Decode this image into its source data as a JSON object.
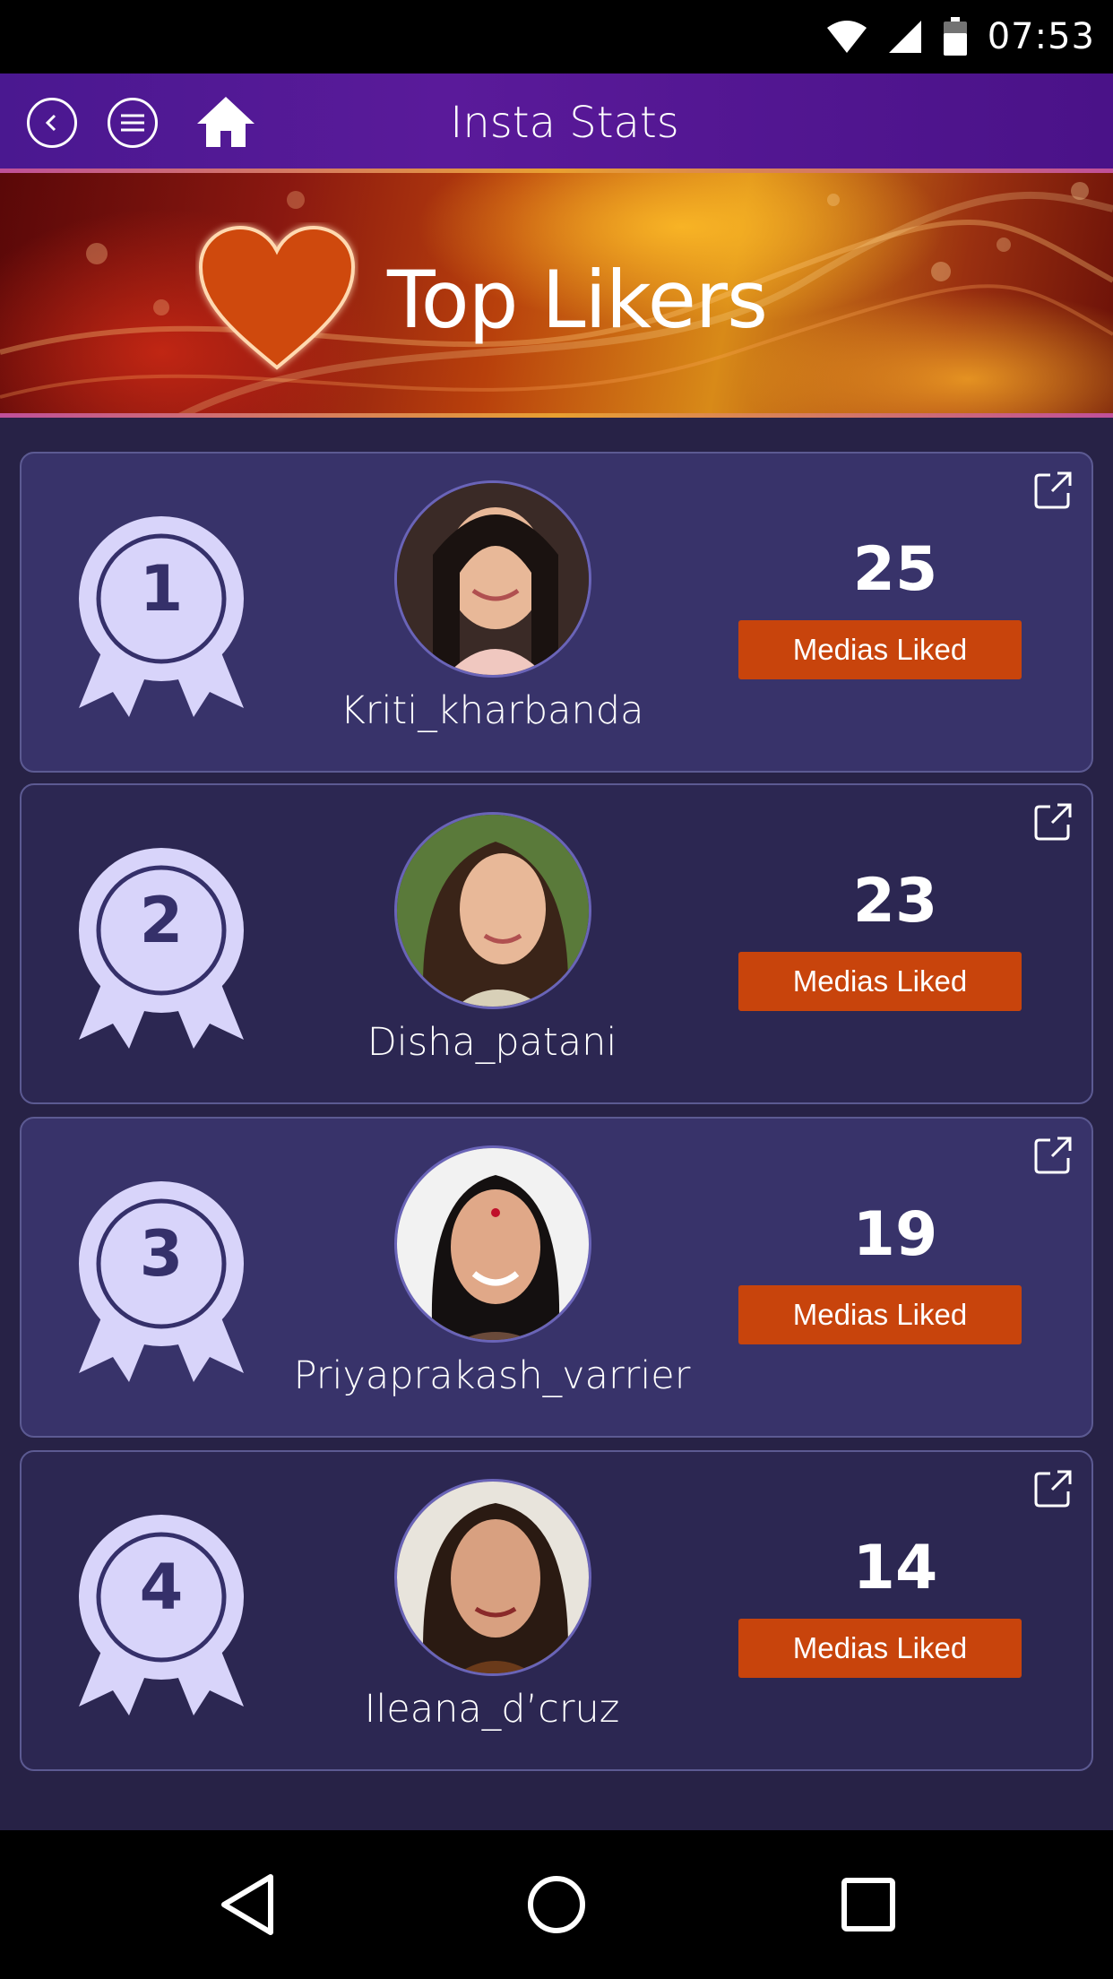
{
  "status_bar": {
    "time": "07:53",
    "icons": [
      "wifi-icon",
      "signal-icon",
      "battery-icon"
    ]
  },
  "app_bar": {
    "title": "Insta Stats",
    "back_icon": "chevron-left-icon",
    "menu_icon": "menu-icon",
    "home_icon": "home-icon"
  },
  "banner": {
    "title": "Top Likers",
    "icon": "heart-icon"
  },
  "likers": [
    {
      "rank": "1",
      "username": "Kriti_kharbanda",
      "count": "25",
      "label": "Medias Liked"
    },
    {
      "rank": "2",
      "username": "Disha_patani",
      "count": "23",
      "label": "Medias Liked"
    },
    {
      "rank": "3",
      "username": "Priyaprakash_varrier",
      "count": "19",
      "label": "Medias Liked"
    },
    {
      "rank": "4",
      "username": "Ileana_d’cruz",
      "count": "14",
      "label": "Medias Liked"
    }
  ],
  "colors": {
    "accent": "#c8440c",
    "card_light": "#38336a",
    "card_dark": "#2c2752",
    "background": "#272246",
    "app_bar": "#4a1890"
  },
  "nav_bar": {
    "icons": [
      "back-triangle-icon",
      "home-circle-icon",
      "recents-square-icon"
    ]
  }
}
